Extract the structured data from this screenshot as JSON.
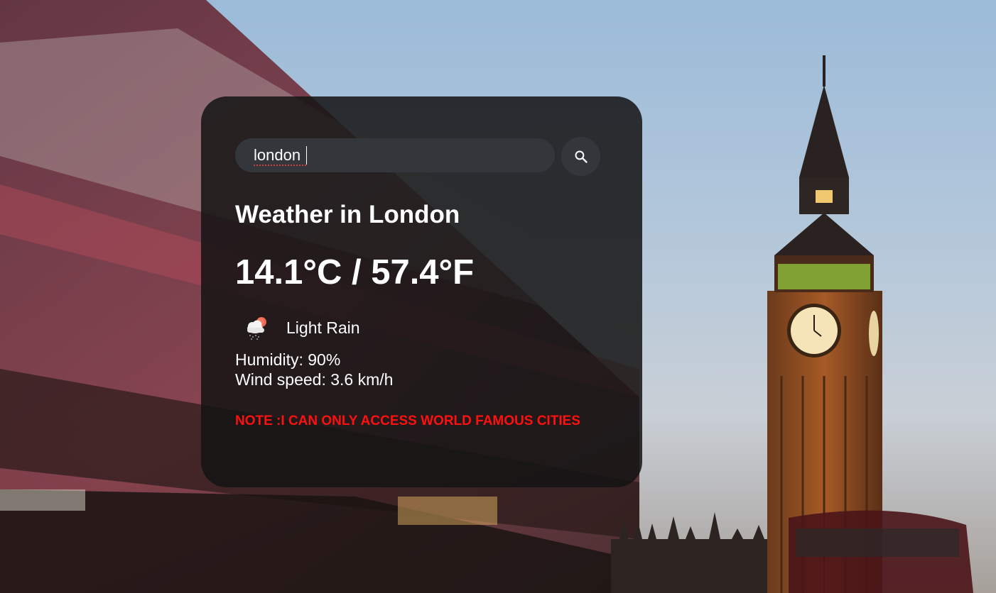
{
  "search": {
    "value": "london",
    "icon": "search-icon"
  },
  "weather": {
    "title": "Weather in London",
    "temperature": "14.1°C / 57.4°F",
    "icon": "cloud-rain-sun-icon",
    "description": "Light Rain",
    "humidity": "Humidity: 90%",
    "wind": "Wind speed: 3.6 km/h"
  },
  "note": "NOTE :I CAN ONLY ACCESS WORLD FAMOUS CITIES",
  "colors": {
    "card_bg": "#141414",
    "input_bg": "#33363a",
    "note": "#ff1010",
    "text": "#ffffff"
  }
}
